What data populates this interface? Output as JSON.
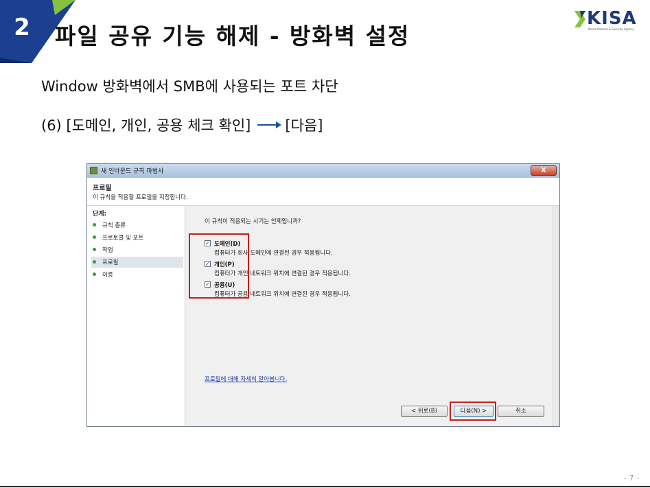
{
  "slide": {
    "badge_number": "2",
    "title": "파일 공유 기능 해제 - 방화벽 설정",
    "logo_text": "KISA",
    "logo_subtext": "Korea Internet & Security Agency",
    "subtitle": "Window 방화벽에서 SMB에 사용되는 포트 차단",
    "step_text": "(6) [도메인, 개인, 공용 체크 확인]",
    "step_target": "[다음]",
    "page_number": "- 7 -"
  },
  "dialog": {
    "window_title": "새 인바운드 규칙 마법사",
    "close_label": "X",
    "header_title": "프로필",
    "header_desc": "이 규칙을 적용할 프로필을 지정합니다.",
    "steps_heading": "단계:",
    "steps": [
      {
        "label": "규칙 종류"
      },
      {
        "label": "프로토콜 및 포트"
      },
      {
        "label": "작업"
      },
      {
        "label": "프로필"
      },
      {
        "label": "이름"
      }
    ],
    "active_step": "프로필",
    "question": "이 규칙이 적용되는 시기는 언제입니까?",
    "options": [
      {
        "name": "도메인(D)",
        "desc": "컴퓨터가 회사 도메인에 연결된 경우 적용됩니다.",
        "checked": true
      },
      {
        "name": "개인(P)",
        "desc": "컴퓨터가 개인 네트워크 위치에 연결된 경우 적용됩니다.",
        "checked": true
      },
      {
        "name": "공용(U)",
        "desc": "컴퓨터가 공용 네트워크 위치에 연결된 경우 적용됩니다.",
        "checked": true
      }
    ],
    "checkmark": "✓",
    "learn_more": "프로필에 대해 자세히 알아봅니다.",
    "buttons": {
      "back": "< 뒤로(B)",
      "next": "다음(N) >",
      "cancel": "취소"
    }
  },
  "colors": {
    "highlight": "#c4201d",
    "badge_blue": "#1c3f8f",
    "badge_green": "#86c23f"
  }
}
